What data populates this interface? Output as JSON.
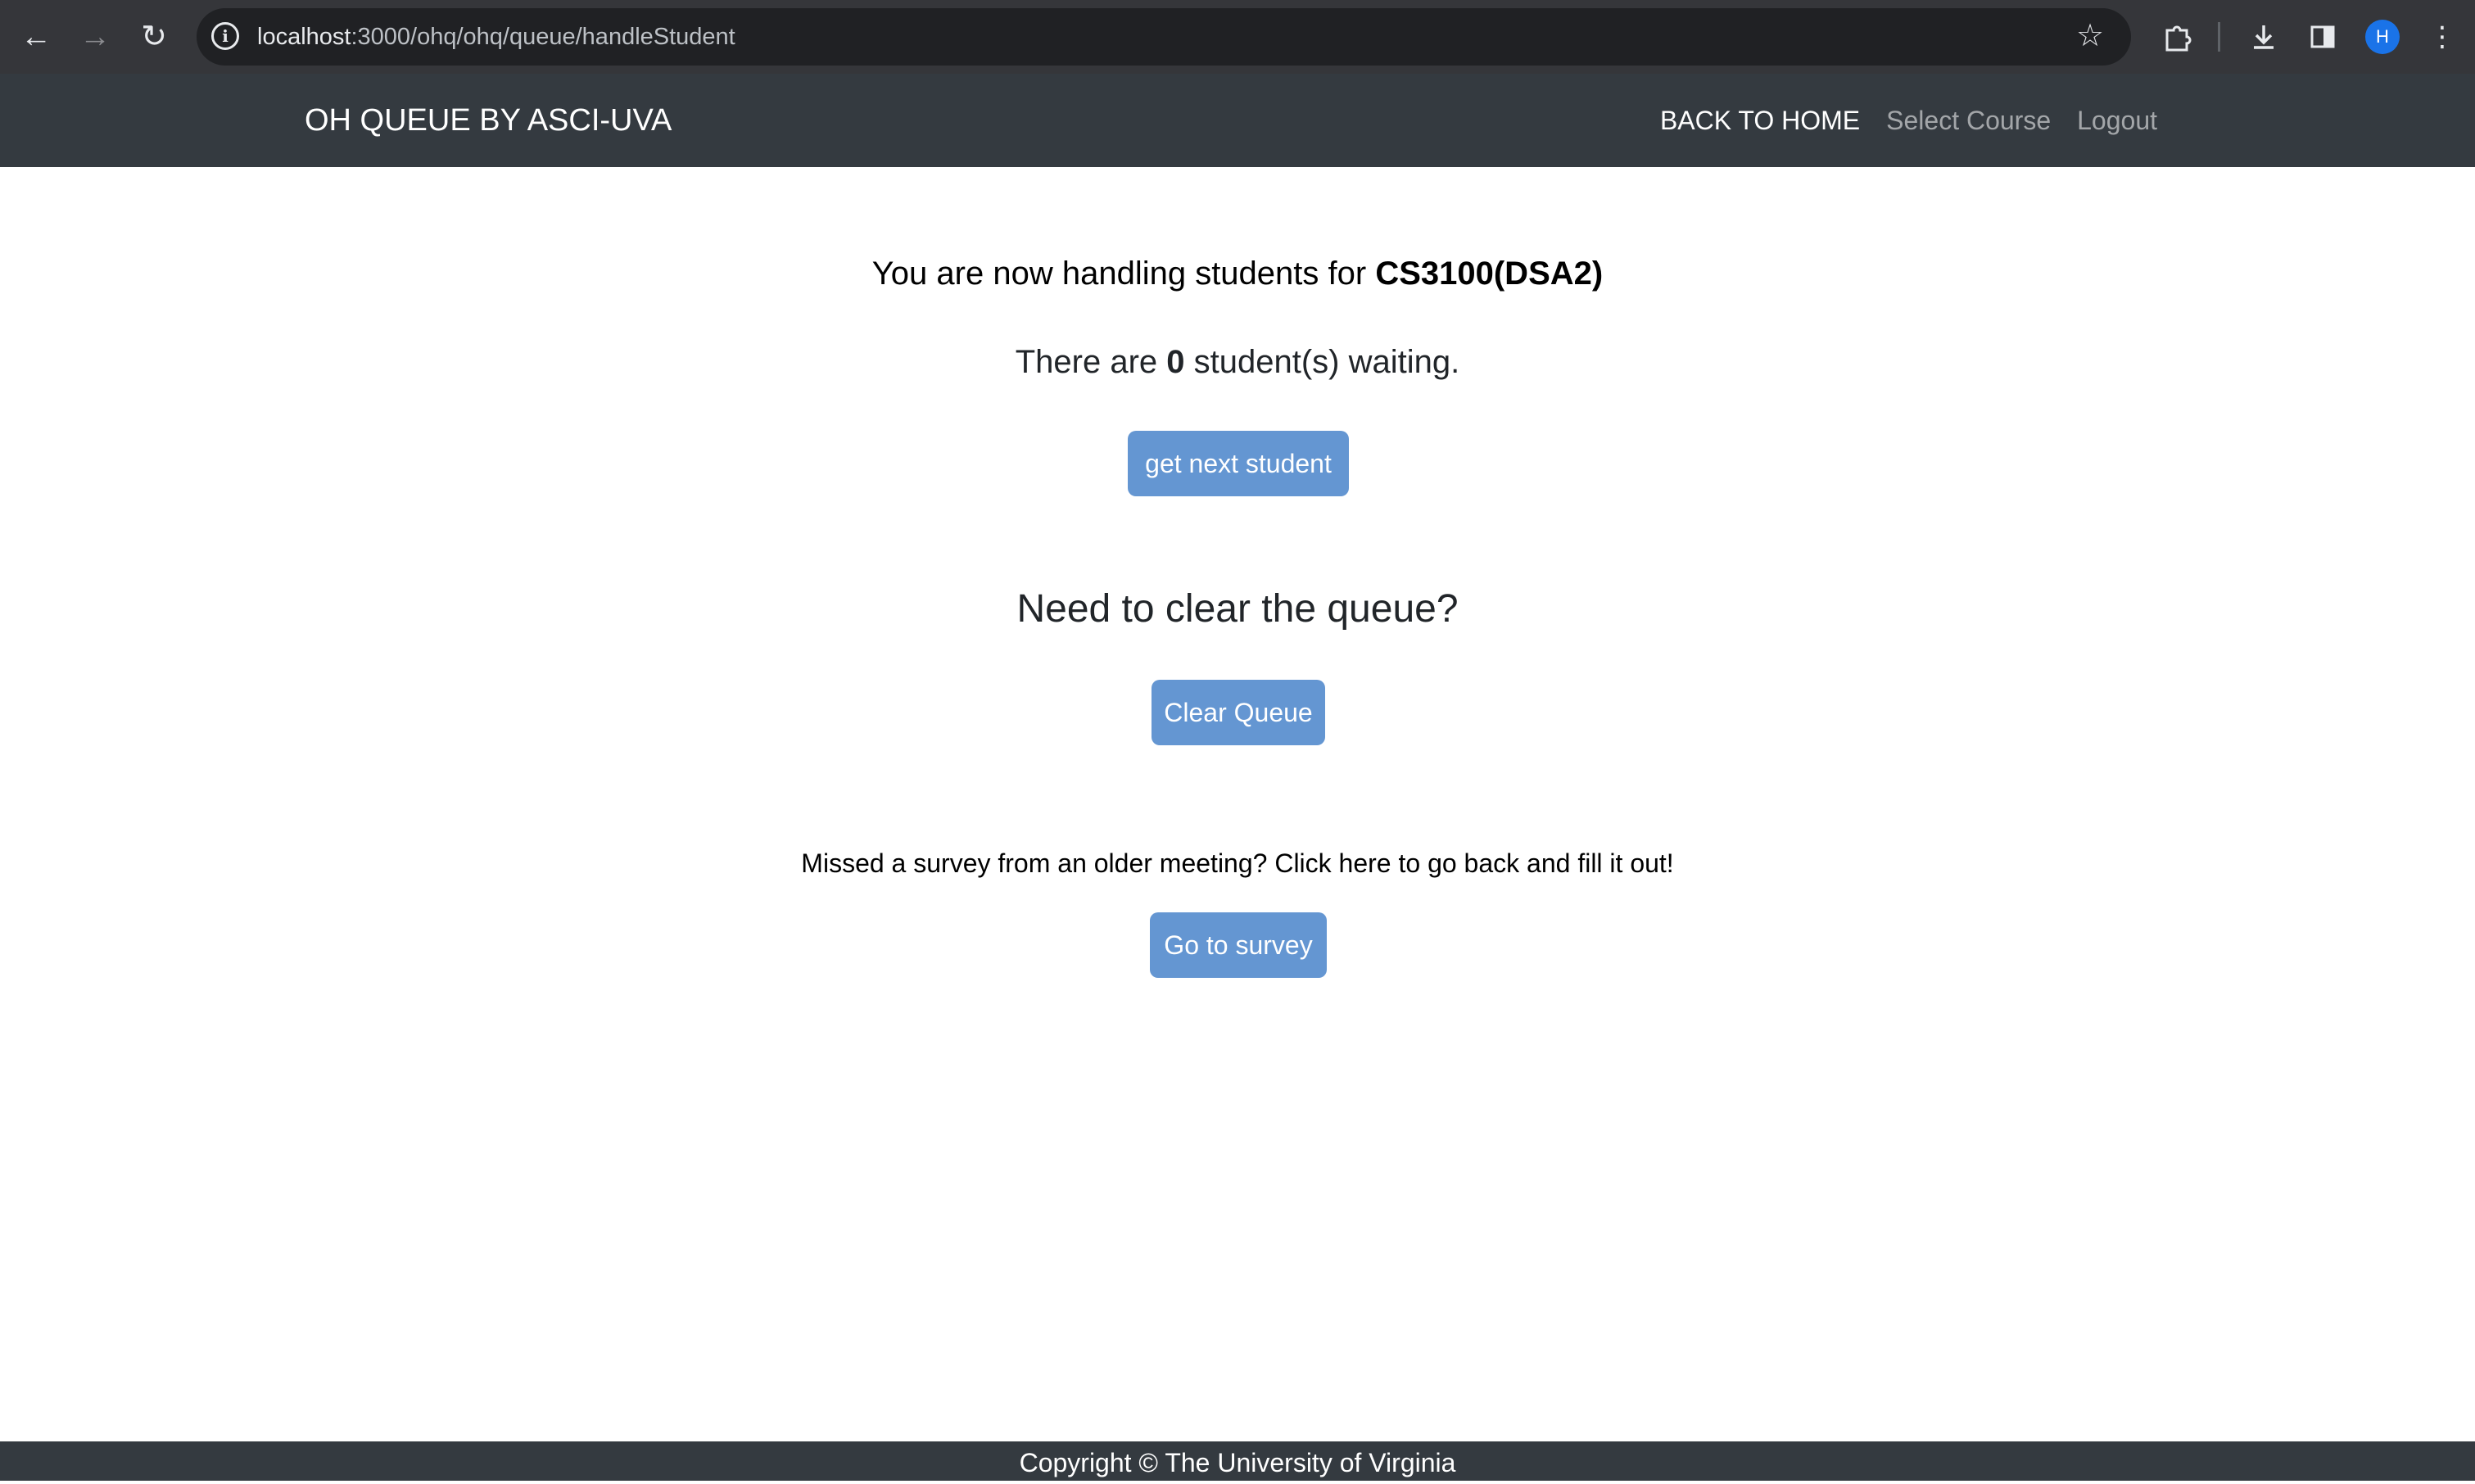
{
  "browser": {
    "url_host": "localhost",
    "url_path": ":3000/ohq/ohq/queue/handleStudent",
    "profile_initial": "H",
    "icons": {
      "back": "back-arrow-icon",
      "forward": "forward-arrow-icon",
      "reload": "reload-icon",
      "site_info": "info-icon",
      "bookmark": "star-icon",
      "extensions": "puzzle-icon",
      "downloads": "download-icon",
      "side_panel": "side-panel-icon",
      "menu": "kebab-menu-icon"
    }
  },
  "navbar": {
    "brand": "OH QUEUE BY ASCI-UVA",
    "links": [
      {
        "label": "BACK TO HOME",
        "active": true
      },
      {
        "label": "Select Course",
        "active": false
      },
      {
        "label": "Logout",
        "active": false
      }
    ]
  },
  "main": {
    "handling_prefix": "You are now handling students for ",
    "course": "CS3100(DSA2)",
    "waiting_prefix": "There are ",
    "waiting_count": "0",
    "waiting_suffix": " student(s) waiting.",
    "next_button": "get next student",
    "clear_heading": "Need to clear the queue?",
    "clear_button": "Clear Queue",
    "survey_text": "Missed a survey from an older meeting? Click here to go back and fill it out!",
    "survey_button": "Go to survey"
  },
  "footer": {
    "text": "Copyright © The University of Virginia"
  },
  "colors": {
    "navbar_bg": "#343a40",
    "button_bg": "#6496d2",
    "chrome_bg": "#35363a",
    "omnibox_bg": "#202124"
  }
}
